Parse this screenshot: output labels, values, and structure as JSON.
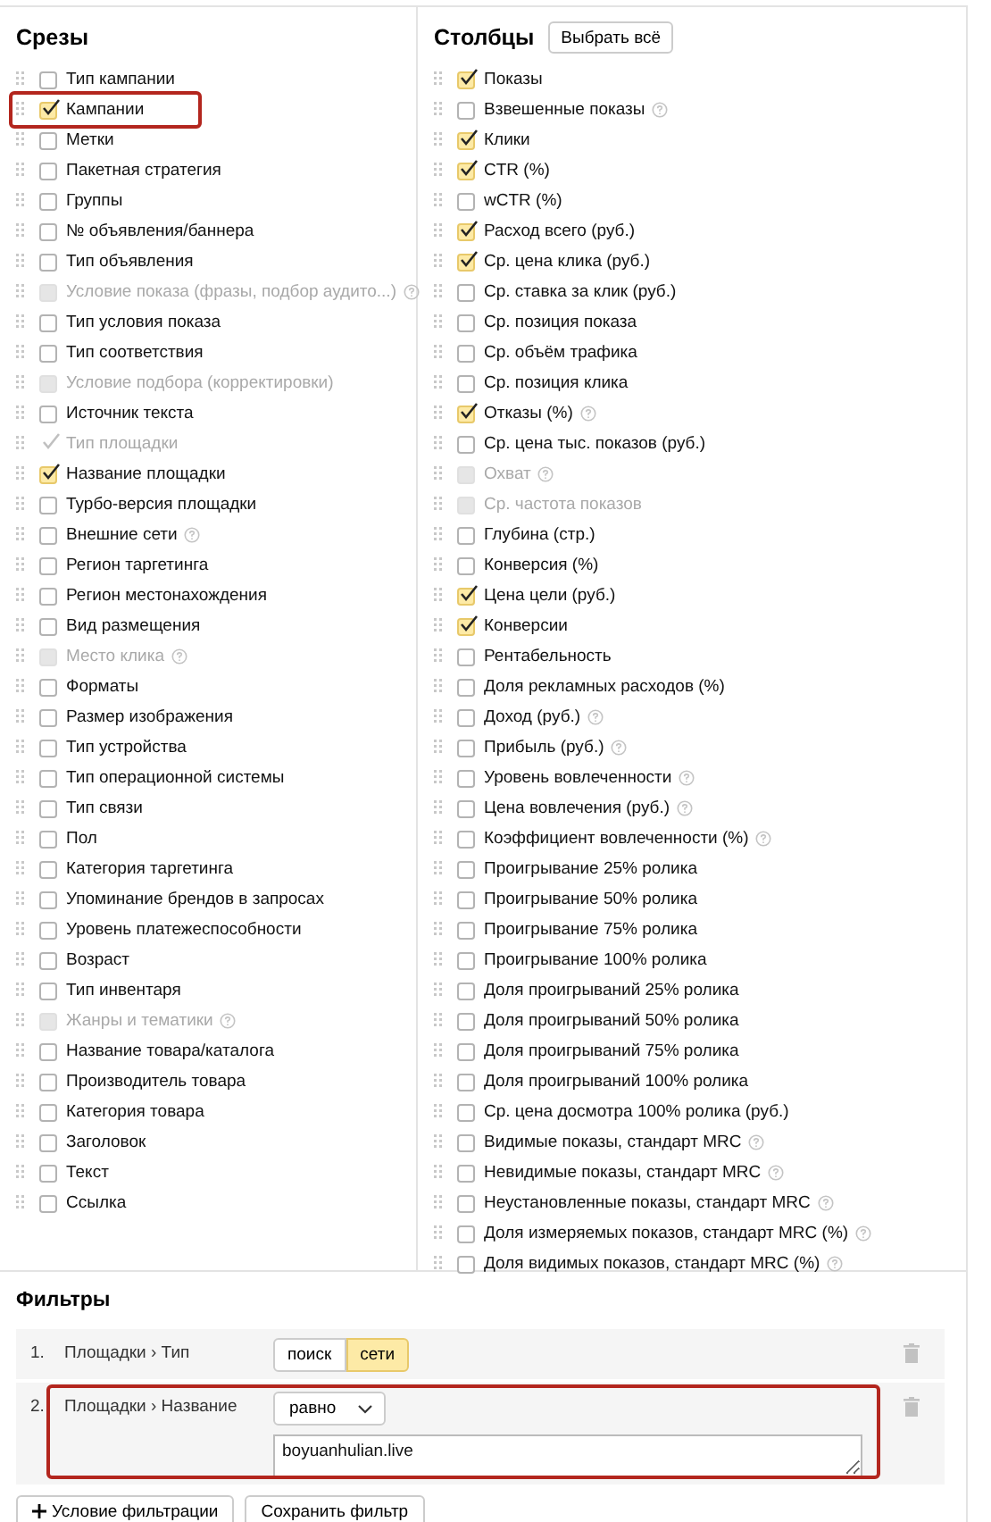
{
  "slices": {
    "title": "Срезы",
    "items": [
      {
        "label": "Тип кампании",
        "checked": false,
        "disabled": false,
        "help": false,
        "highlighted": false
      },
      {
        "label": "Кампании",
        "checked": true,
        "disabled": false,
        "help": false,
        "highlighted": true
      },
      {
        "label": "Метки",
        "checked": false,
        "disabled": false,
        "help": false,
        "highlighted": false
      },
      {
        "label": "Пакетная стратегия",
        "checked": false,
        "disabled": false,
        "help": false,
        "highlighted": false
      },
      {
        "label": "Группы",
        "checked": false,
        "disabled": false,
        "help": false,
        "highlighted": false
      },
      {
        "label": "№ объявления/баннера",
        "checked": false,
        "disabled": false,
        "help": false,
        "highlighted": false
      },
      {
        "label": "Тип объявления",
        "checked": false,
        "disabled": false,
        "help": false,
        "highlighted": false
      },
      {
        "label": "Условие показа (фразы, подбор аудито...)",
        "checked": false,
        "disabled": true,
        "help": true,
        "highlighted": false
      },
      {
        "label": "Тип условия показа",
        "checked": false,
        "disabled": false,
        "help": false,
        "highlighted": false
      },
      {
        "label": "Тип соответствия",
        "checked": false,
        "disabled": false,
        "help": false,
        "highlighted": false
      },
      {
        "label": "Условие подбора (корректировки)",
        "checked": false,
        "disabled": true,
        "help": false,
        "highlighted": false
      },
      {
        "label": "Источник текста",
        "checked": false,
        "disabled": false,
        "help": false,
        "highlighted": false
      },
      {
        "label": "Тип площадки",
        "checked": true,
        "disabled": true,
        "help": false,
        "highlighted": false
      },
      {
        "label": "Название площадки",
        "checked": true,
        "disabled": false,
        "help": false,
        "highlighted": false
      },
      {
        "label": "Турбо-версия площадки",
        "checked": false,
        "disabled": false,
        "help": false,
        "highlighted": false
      },
      {
        "label": "Внешние сети",
        "checked": false,
        "disabled": false,
        "help": true,
        "highlighted": false
      },
      {
        "label": "Регион таргетинга",
        "checked": false,
        "disabled": false,
        "help": false,
        "highlighted": false
      },
      {
        "label": "Регион местонахождения",
        "checked": false,
        "disabled": false,
        "help": false,
        "highlighted": false
      },
      {
        "label": "Вид размещения",
        "checked": false,
        "disabled": false,
        "help": false,
        "highlighted": false
      },
      {
        "label": "Место клика",
        "checked": false,
        "disabled": true,
        "help": true,
        "highlighted": false
      },
      {
        "label": "Форматы",
        "checked": false,
        "disabled": false,
        "help": false,
        "highlighted": false
      },
      {
        "label": "Размер изображения",
        "checked": false,
        "disabled": false,
        "help": false,
        "highlighted": false
      },
      {
        "label": "Тип устройства",
        "checked": false,
        "disabled": false,
        "help": false,
        "highlighted": false
      },
      {
        "label": "Тип операционной системы",
        "checked": false,
        "disabled": false,
        "help": false,
        "highlighted": false
      },
      {
        "label": "Тип связи",
        "checked": false,
        "disabled": false,
        "help": false,
        "highlighted": false
      },
      {
        "label": "Пол",
        "checked": false,
        "disabled": false,
        "help": false,
        "highlighted": false
      },
      {
        "label": "Категория таргетинга",
        "checked": false,
        "disabled": false,
        "help": false,
        "highlighted": false
      },
      {
        "label": "Упоминание брендов в запросах",
        "checked": false,
        "disabled": false,
        "help": false,
        "highlighted": false
      },
      {
        "label": "Уровень платежеспособности",
        "checked": false,
        "disabled": false,
        "help": false,
        "highlighted": false
      },
      {
        "label": "Возраст",
        "checked": false,
        "disabled": false,
        "help": false,
        "highlighted": false
      },
      {
        "label": "Тип инвентаря",
        "checked": false,
        "disabled": false,
        "help": false,
        "highlighted": false
      },
      {
        "label": "Жанры и тематики",
        "checked": false,
        "disabled": true,
        "help": true,
        "highlighted": false
      },
      {
        "label": "Название товара/каталога",
        "checked": false,
        "disabled": false,
        "help": false,
        "highlighted": false
      },
      {
        "label": "Производитель товара",
        "checked": false,
        "disabled": false,
        "help": false,
        "highlighted": false
      },
      {
        "label": "Категория товара",
        "checked": false,
        "disabled": false,
        "help": false,
        "highlighted": false
      },
      {
        "label": "Заголовок",
        "checked": false,
        "disabled": false,
        "help": false,
        "highlighted": false
      },
      {
        "label": "Текст",
        "checked": false,
        "disabled": false,
        "help": false,
        "highlighted": false
      },
      {
        "label": "Ссылка",
        "checked": false,
        "disabled": false,
        "help": false,
        "highlighted": false
      }
    ]
  },
  "columns": {
    "title": "Столбцы",
    "select_all": "Выбрать всё",
    "items": [
      {
        "label": "Показы",
        "checked": true,
        "disabled": false,
        "help": false
      },
      {
        "label": "Взвешенные показы",
        "checked": false,
        "disabled": false,
        "help": true
      },
      {
        "label": "Клики",
        "checked": true,
        "disabled": false,
        "help": false
      },
      {
        "label": "CTR (%)",
        "checked": true,
        "disabled": false,
        "help": false
      },
      {
        "label": "wCTR (%)",
        "checked": false,
        "disabled": false,
        "help": false
      },
      {
        "label": "Расход всего (руб.)",
        "checked": true,
        "disabled": false,
        "help": false
      },
      {
        "label": "Ср. цена клика (руб.)",
        "checked": true,
        "disabled": false,
        "help": false
      },
      {
        "label": "Ср. ставка за клик (руб.)",
        "checked": false,
        "disabled": false,
        "help": false
      },
      {
        "label": "Ср. позиция показа",
        "checked": false,
        "disabled": false,
        "help": false
      },
      {
        "label": "Ср. объём трафика",
        "checked": false,
        "disabled": false,
        "help": false
      },
      {
        "label": "Ср. позиция клика",
        "checked": false,
        "disabled": false,
        "help": false
      },
      {
        "label": "Отказы (%)",
        "checked": true,
        "disabled": false,
        "help": true
      },
      {
        "label": "Ср. цена тыс. показов (руб.)",
        "checked": false,
        "disabled": false,
        "help": false
      },
      {
        "label": "Охват",
        "checked": false,
        "disabled": true,
        "help": true
      },
      {
        "label": "Ср. частота показов",
        "checked": false,
        "disabled": true,
        "help": false
      },
      {
        "label": "Глубина (стр.)",
        "checked": false,
        "disabled": false,
        "help": false
      },
      {
        "label": "Конверсия (%)",
        "checked": false,
        "disabled": false,
        "help": false
      },
      {
        "label": "Цена цели (руб.)",
        "checked": true,
        "disabled": false,
        "help": false
      },
      {
        "label": "Конверсии",
        "checked": true,
        "disabled": false,
        "help": false
      },
      {
        "label": "Рентабельность",
        "checked": false,
        "disabled": false,
        "help": false
      },
      {
        "label": "Доля рекламных расходов (%)",
        "checked": false,
        "disabled": false,
        "help": false
      },
      {
        "label": "Доход (руб.)",
        "checked": false,
        "disabled": false,
        "help": true
      },
      {
        "label": "Прибыль (руб.)",
        "checked": false,
        "disabled": false,
        "help": true
      },
      {
        "label": "Уровень вовлеченности",
        "checked": false,
        "disabled": false,
        "help": true
      },
      {
        "label": "Цена вовлечения (руб.)",
        "checked": false,
        "disabled": false,
        "help": true
      },
      {
        "label": "Коэффициент вовлеченности (%)",
        "checked": false,
        "disabled": false,
        "help": true
      },
      {
        "label": "Проигрывание 25% ролика",
        "checked": false,
        "disabled": false,
        "help": false
      },
      {
        "label": "Проигрывание 50% ролика",
        "checked": false,
        "disabled": false,
        "help": false
      },
      {
        "label": "Проигрывание 75% ролика",
        "checked": false,
        "disabled": false,
        "help": false
      },
      {
        "label": "Проигрывание 100% ролика",
        "checked": false,
        "disabled": false,
        "help": false
      },
      {
        "label": "Доля проигрываний 25% ролика",
        "checked": false,
        "disabled": false,
        "help": false
      },
      {
        "label": "Доля проигрываний 50% ролика",
        "checked": false,
        "disabled": false,
        "help": false
      },
      {
        "label": "Доля проигрываний 75% ролика",
        "checked": false,
        "disabled": false,
        "help": false
      },
      {
        "label": "Доля проигрываний 100% ролика",
        "checked": false,
        "disabled": false,
        "help": false
      },
      {
        "label": "Ср. цена досмотра 100% ролика (руб.)",
        "checked": false,
        "disabled": false,
        "help": false
      },
      {
        "label": "Видимые показы, стандарт MRC",
        "checked": false,
        "disabled": false,
        "help": true
      },
      {
        "label": "Невидимые показы, стандарт MRC",
        "checked": false,
        "disabled": false,
        "help": true
      },
      {
        "label": "Неустановленные показы, стандарт MRC",
        "checked": false,
        "disabled": false,
        "help": true
      },
      {
        "label": "Доля измеряемых показов, стандарт MRC (%)",
        "checked": false,
        "disabled": false,
        "help": true
      },
      {
        "label": "Доля видимых показов, стандарт MRC (%)",
        "checked": false,
        "disabled": false,
        "help": true
      }
    ]
  },
  "filters": {
    "title": "Фильтры",
    "rows": [
      {
        "number": "1.",
        "field": "Площадки › Тип",
        "kind": "toggle",
        "highlighted": false,
        "options": [
          {
            "label": "поиск",
            "selected": false
          },
          {
            "label": "сети",
            "selected": true
          }
        ]
      },
      {
        "number": "2.",
        "field": "Площадки › Название",
        "kind": "match",
        "highlighted": true,
        "operator": "равно",
        "value": "boyuanhulian.live"
      }
    ],
    "buttons": [
      {
        "label": "Условие фильтрации",
        "kind": "add"
      },
      {
        "label": "Сохранить фильтр",
        "kind": "plain"
      }
    ]
  }
}
